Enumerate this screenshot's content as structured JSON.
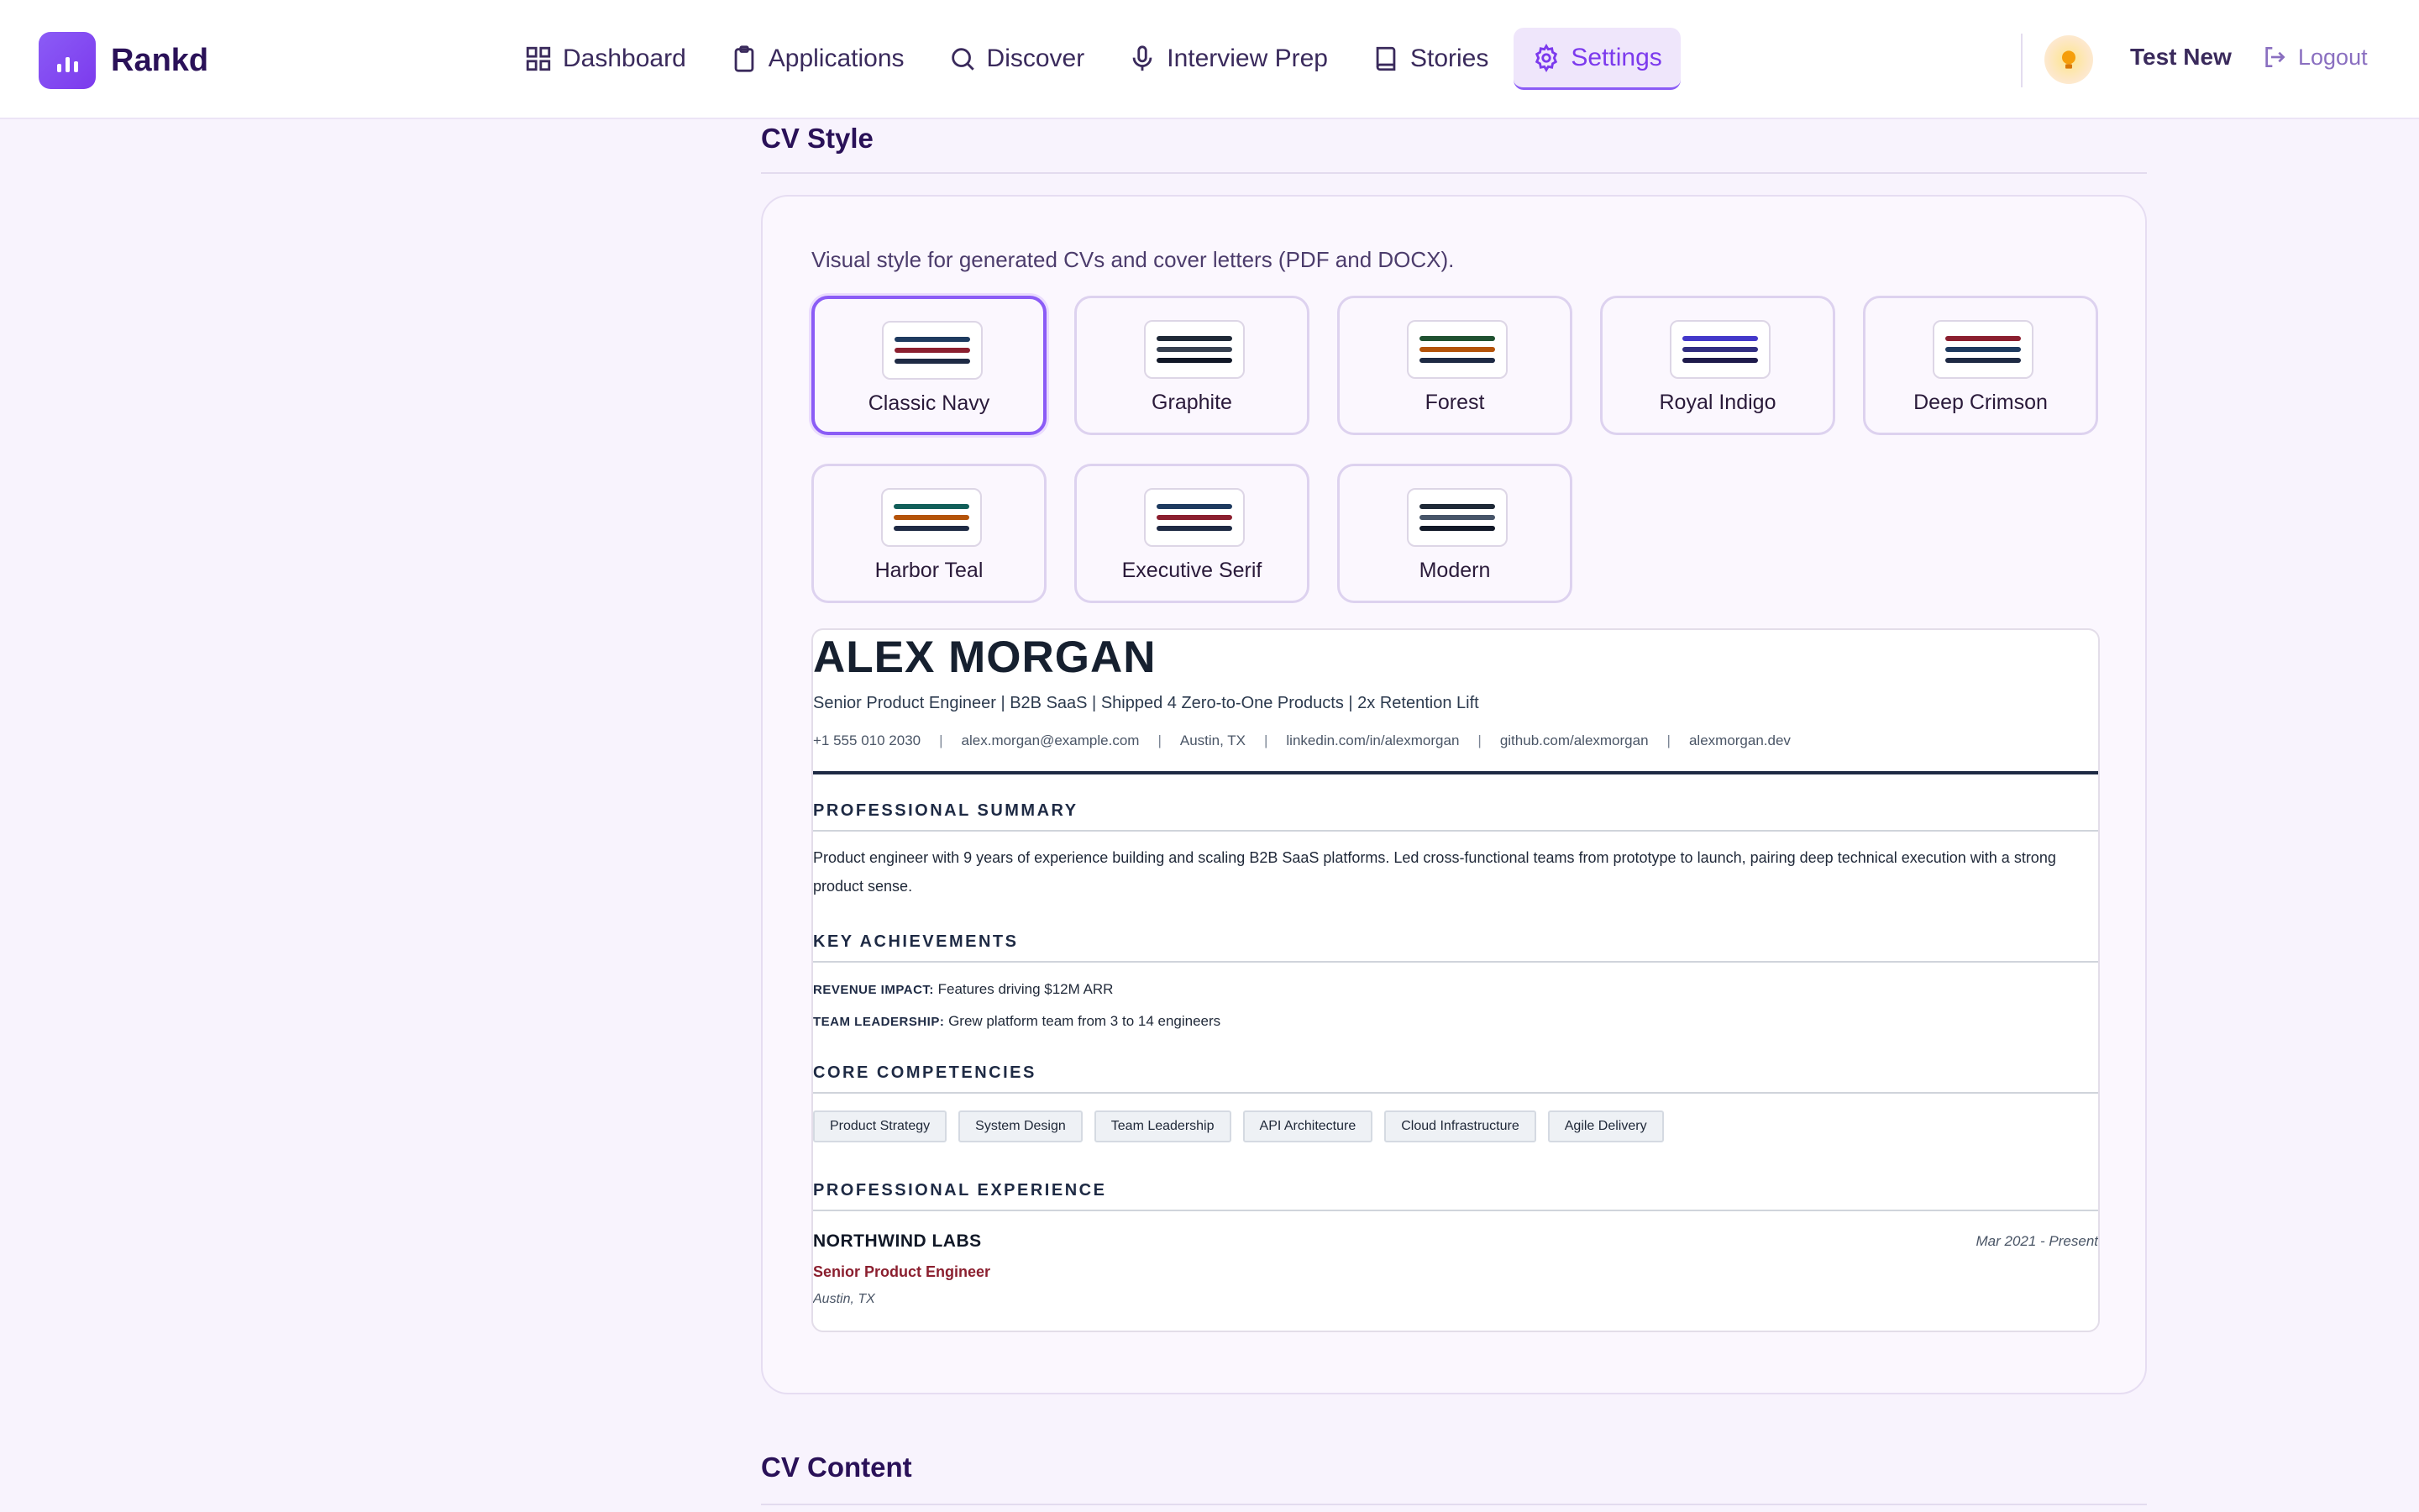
{
  "app": {
    "name": "Rankd"
  },
  "nav": [
    {
      "label": "Dashboard",
      "icon": "grid-icon",
      "active": false
    },
    {
      "label": "Applications",
      "icon": "clipboard-icon",
      "active": false
    },
    {
      "label": "Discover",
      "icon": "search-icon",
      "active": false
    },
    {
      "label": "Interview Prep",
      "icon": "microphone-icon",
      "active": false
    },
    {
      "label": "Stories",
      "icon": "book-icon",
      "active": false
    },
    {
      "label": "Settings",
      "icon": "gear-icon",
      "active": true
    }
  ],
  "user": {
    "name": "Test New",
    "logout_label": "Logout"
  },
  "cv_style": {
    "title": "CV Style",
    "description": "Visual style for generated CVs and cover letters (PDF and DOCX).",
    "styles": [
      {
        "label": "Classic Navy",
        "selected": true,
        "colors": [
          "#1e3a5f",
          "#8b1f2f",
          "#1e2a44"
        ]
      },
      {
        "label": "Graphite",
        "selected": false,
        "colors": [
          "#1f2937",
          "#374151",
          "#111827"
        ]
      },
      {
        "label": "Forest",
        "selected": false,
        "colors": [
          "#1f5130",
          "#b45309",
          "#1e2a44"
        ]
      },
      {
        "label": "Royal Indigo",
        "selected": false,
        "colors": [
          "#4338ca",
          "#312e81",
          "#1e1b4b"
        ]
      },
      {
        "label": "Deep Crimson",
        "selected": false,
        "colors": [
          "#8b1f2f",
          "#1e3a5f",
          "#1e2a44"
        ]
      },
      {
        "label": "Harbor Teal",
        "selected": false,
        "colors": [
          "#115e59",
          "#b45309",
          "#1e2a44"
        ]
      },
      {
        "label": "Executive Serif",
        "selected": false,
        "colors": [
          "#1e3a5f",
          "#8b1f2f",
          "#1e2a44"
        ]
      },
      {
        "label": "Modern",
        "selected": false,
        "colors": [
          "#1f2937",
          "#475569",
          "#111827"
        ]
      }
    ]
  },
  "cv_preview": {
    "name": "ALEX MORGAN",
    "headline": "Senior Product Engineer  |  B2B SaaS  |  Shipped 4 Zero-to-One Products  |  2x Retention Lift",
    "contact": [
      "+1 555 010 2030",
      "alex.morgan@example.com",
      "Austin, TX",
      "linkedin.com/in/alexmorgan",
      "github.com/alexmorgan",
      "alexmorgan.dev"
    ],
    "contact_separator": "|",
    "summary_heading": "PROFESSIONAL SUMMARY",
    "summary": "Product engineer with 9 years of experience building and scaling B2B SaaS platforms. Led cross-functional teams from prototype to launch, pairing deep technical execution with a strong product sense.",
    "achievements_heading": "KEY ACHIEVEMENTS",
    "achievements": [
      {
        "label": "REVENUE IMPACT:",
        "text": "Features driving $12M ARR"
      },
      {
        "label": "TEAM LEADERSHIP:",
        "text": "Grew platform team from 3 to 14 engineers"
      }
    ],
    "competencies_heading": "CORE COMPETENCIES",
    "competencies": [
      "Product Strategy",
      "System Design",
      "Team Leadership",
      "API Architecture",
      "Cloud Infrastructure",
      "Agile Delivery"
    ],
    "experience_heading": "PROFESSIONAL EXPERIENCE",
    "experience": {
      "company": "NORTHWIND LABS",
      "dates": "Mar 2021 - Present",
      "role": "Senior Product Engineer",
      "location": "Austin, TX"
    }
  },
  "cv_content": {
    "title": "CV Content"
  }
}
